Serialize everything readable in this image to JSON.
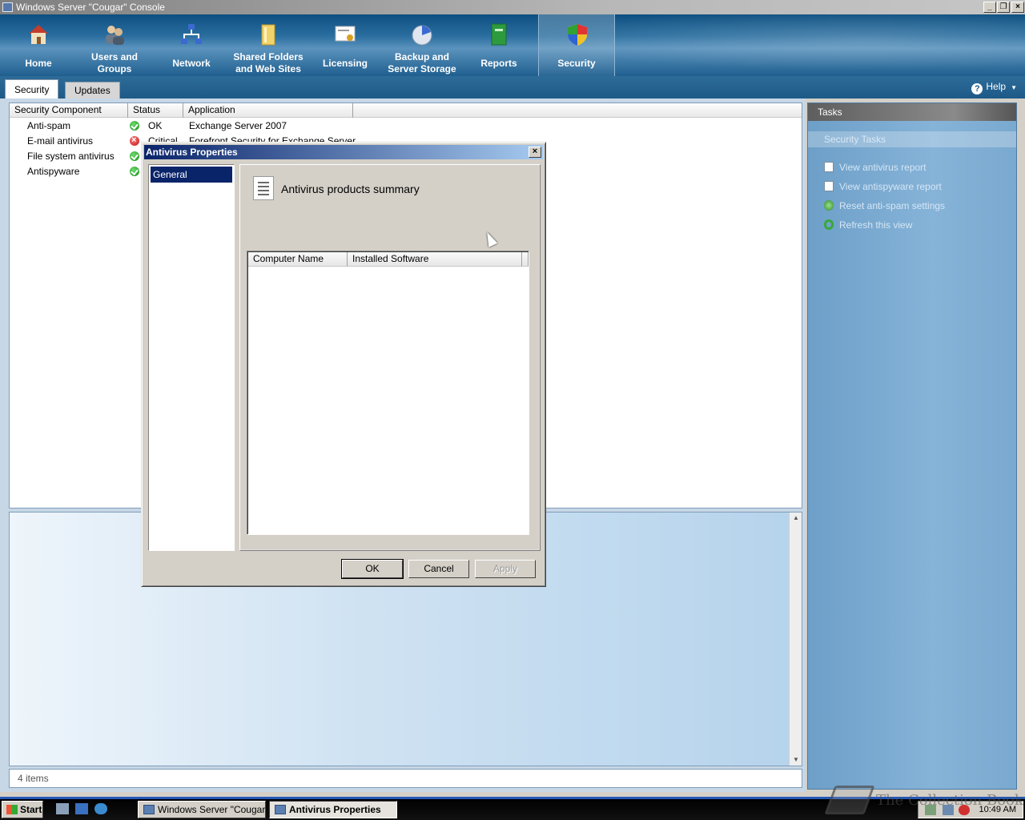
{
  "window": {
    "title": "Windows Server \"Cougar\" Console"
  },
  "nav": {
    "items": [
      {
        "label": "Home",
        "icon": "home-icon"
      },
      {
        "label": "Users and\nGroups",
        "icon": "users-icon"
      },
      {
        "label": "Network",
        "icon": "network-icon"
      },
      {
        "label": "Shared Folders\nand Web Sites",
        "icon": "folder-icon"
      },
      {
        "label": "Licensing",
        "icon": "certificate-icon"
      },
      {
        "label": "Backup and\nServer Storage",
        "icon": "backup-icon"
      },
      {
        "label": "Reports",
        "icon": "report-book-icon"
      },
      {
        "label": "Security",
        "icon": "shield-icon",
        "active": true
      }
    ]
  },
  "subtabs": {
    "security": "Security",
    "updates": "Updates",
    "help": "Help"
  },
  "list": {
    "columns": [
      "Security Component",
      "Status",
      "Application"
    ],
    "rows": [
      {
        "component": "Anti-spam",
        "status": "OK",
        "status_kind": "ok",
        "application": "Exchange Server 2007"
      },
      {
        "component": "E-mail antivirus",
        "status": "Critical",
        "status_kind": "error",
        "application": "Forefront Security for Exchange Server"
      },
      {
        "component": "File system antivirus",
        "status": "",
        "status_kind": "ok",
        "application": ""
      },
      {
        "component": "Antispyware",
        "status": "",
        "status_kind": "ok",
        "application": ""
      }
    ]
  },
  "statusbar": {
    "text": "4 items"
  },
  "tasks": {
    "title": "Tasks",
    "section": "Security Tasks",
    "items": [
      {
        "label": "View antivirus report",
        "icon": "document-icon"
      },
      {
        "label": "View antispyware report",
        "icon": "document-icon"
      },
      {
        "label": "Reset anti-spam settings",
        "icon": "reset-icon"
      },
      {
        "label": "Refresh this view",
        "icon": "refresh-icon"
      }
    ]
  },
  "dialog": {
    "title": "Antivirus Properties",
    "nav_item": "General",
    "page_title": "Antivirus products summary",
    "columns": [
      "Computer Name",
      "Installed Software"
    ],
    "ok": "OK",
    "cancel": "Cancel",
    "apply": "Apply"
  },
  "taskbar": {
    "start": "Start",
    "buttons": [
      "Windows Server \"Cougar...",
      "Antivirus Properties"
    ],
    "clock": "10:49 AM"
  },
  "watermark": {
    "text": "The Collection Book"
  },
  "colors": {
    "nav_blue": "#1e5a88",
    "dialog_title": "#0a246a",
    "tasks_blue": "#86b3d8"
  }
}
